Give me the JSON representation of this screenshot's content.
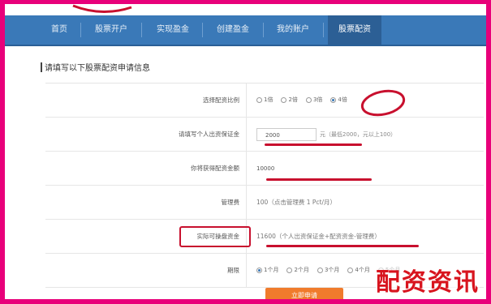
{
  "nav": {
    "items": [
      "首页",
      "股票开户",
      "实现盈金",
      "创建盈金",
      "我的账户",
      "股票配资"
    ],
    "active_index": 5
  },
  "section_title": "请填写以下股票配资申请信息",
  "form": {
    "rows": [
      {
        "label": "选择配资比例",
        "type": "radio",
        "options": [
          "1倍",
          "2倍",
          "3倍",
          "4倍"
        ],
        "checked": 3
      },
      {
        "label": "请填写个人出资保证金",
        "type": "input",
        "value": "2000",
        "hint": "元（最低2000，元以上100）"
      },
      {
        "label": "你将获得配资金额",
        "type": "input-wide",
        "value": "10000",
        "hint": ""
      },
      {
        "label": "管理费",
        "type": "text",
        "value": "100（点击管理费 1 Pct/月）"
      },
      {
        "label": "实际可操盘资金",
        "type": "text",
        "value": "11600（个人出资保证金+配资资金-管理费）"
      },
      {
        "label": "期限",
        "type": "radio",
        "options": [
          "1个月",
          "2个月",
          "3个月",
          "4个月",
          "5个月"
        ],
        "checked": 0
      }
    ]
  },
  "submit_label": "立即申请",
  "watermark": "配资资讯",
  "colors": {
    "nav_bg": "#3a79b8",
    "accent_red": "#c8102e",
    "frame": "#e8007a",
    "button": "#f07b2c"
  }
}
